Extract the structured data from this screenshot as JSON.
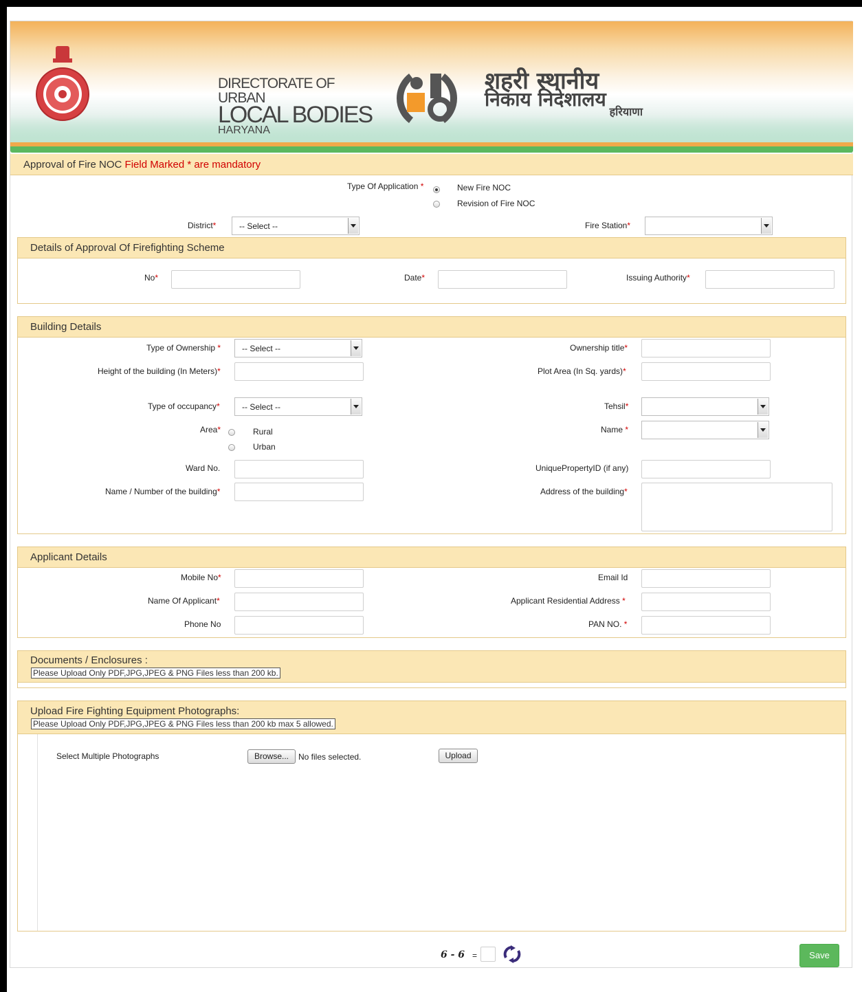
{
  "header": {
    "dulb_line1": "DIRECTORATE OF URBAN",
    "dulb_line2": "LOCAL BODIES",
    "dulb_line3": "HARYANA",
    "hindi_line1": "शहरी स्थानीय",
    "hindi_line2": "निकाय निदेशालय",
    "hindi_line3": "हरियाणा"
  },
  "form_title": {
    "prefix": "Approval of Fire NOC ",
    "mandatory": "Field Marked * are mandatory"
  },
  "application": {
    "type_label": "Type Of Application",
    "option_new": "New Fire NOC",
    "option_revision": "Revision of Fire NOC",
    "selected": "New Fire NOC",
    "district_label": "District",
    "district_value": "-- Select --",
    "fire_station_label": "Fire Station",
    "fire_station_value": ""
  },
  "scheme": {
    "heading": "Details of Approval Of Firefighting Scheme",
    "no_label": "No",
    "date_label": "Date",
    "issuing_label": "Issuing Authority"
  },
  "building": {
    "heading": "Building Details",
    "ownership_type_label": "Type of Ownership ",
    "ownership_type_value": "-- Select --",
    "ownership_title_label": "Ownership title",
    "height_label": "Height of the building (In Meters)",
    "plot_area_label": "Plot Area (In Sq. yards)",
    "occupancy_label": "Type of occupancy",
    "occupancy_value": "-- Select --",
    "tehsil_label": "Tehsil",
    "area_label": "Area",
    "area_rural": "Rural",
    "area_urban": "Urban",
    "name_label": "Name ",
    "ward_label": "Ward No.",
    "unique_label": "UniquePropertyID (if any)",
    "bldg_name_label": "Name / Number of the building",
    "address_label": "Address of the building"
  },
  "applicant": {
    "heading": "Applicant Details",
    "mobile_label": "Mobile No",
    "email_label": "Email Id",
    "name_label": "Name Of Applicant",
    "residential_label": "Applicant Residential Address ",
    "phone_label": "Phone No",
    "pan_label": "PAN NO. "
  },
  "documents": {
    "heading": "Documents / Enclosures :",
    "note": "Please Upload Only PDF,JPG,JPEG & PNG Files less than 200 kb."
  },
  "photos": {
    "heading": "Upload Fire Fighting Equipment Photographs:",
    "note": "Please Upload Only PDF,JPG,JPEG & PNG Files less than 200 kb max 5 allowed.",
    "select_label": "Select Multiple Photographs",
    "browse_label": "Browse...",
    "no_files": "No files selected.",
    "upload_label": "Upload"
  },
  "captcha": {
    "question": "6 - 6",
    "equals": "="
  },
  "actions": {
    "save_label": "Save"
  },
  "colors": {
    "panel_header": "#fbe7b5",
    "panel_border": "#e4c98a",
    "required": "#d10000",
    "save_button": "#5cb85c",
    "orange_stripe": "#f0a94b",
    "green_stripe": "#5bb85f"
  },
  "icons": {
    "emblem": "haryana-emblem-icon",
    "logo": "dulb-logo-icon",
    "refresh": "refresh-icon"
  }
}
